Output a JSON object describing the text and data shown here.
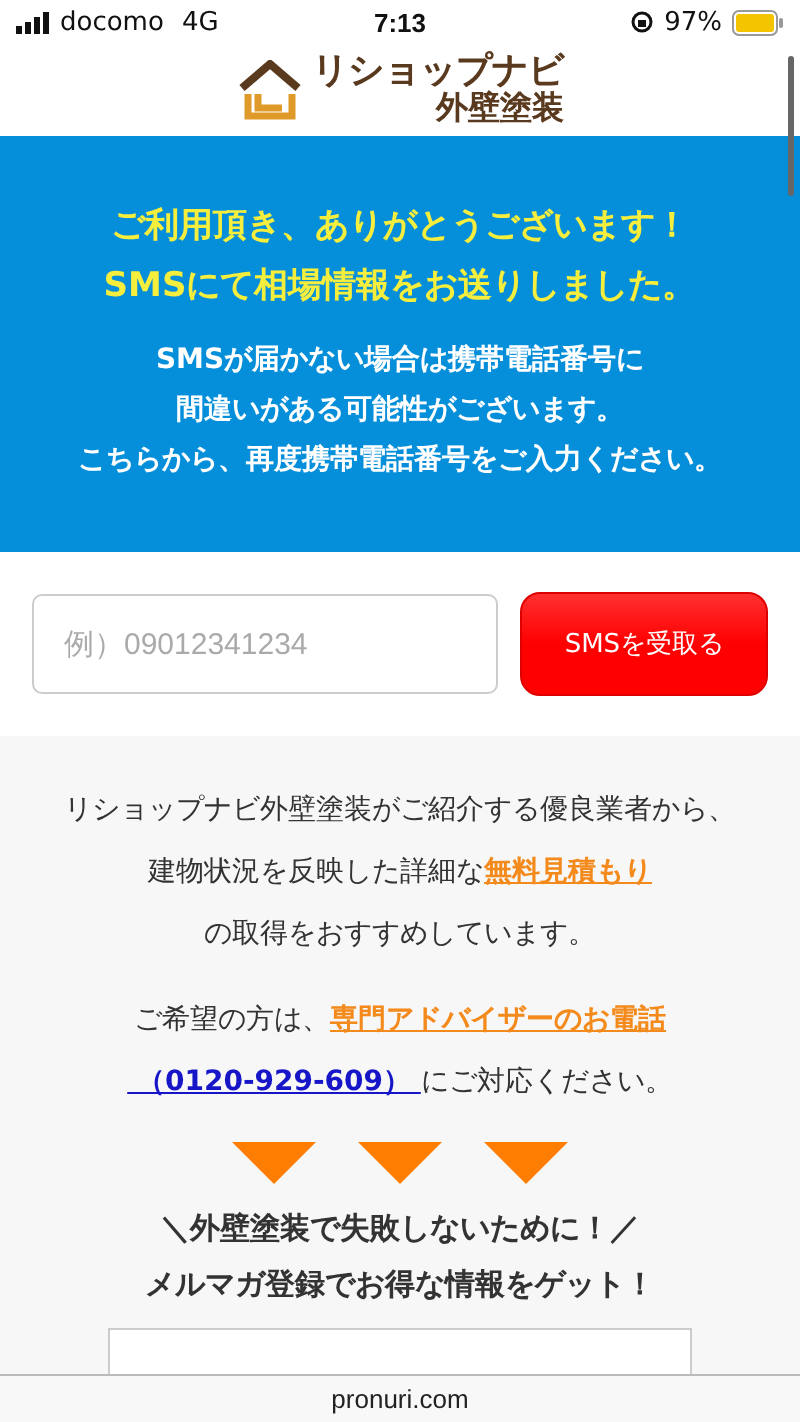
{
  "status_bar": {
    "carrier": "docomo",
    "network": "4G",
    "time": "7:13",
    "battery": "97%"
  },
  "header": {
    "logo_line_1": "リショップナビ",
    "logo_line_2": "外壁塗装"
  },
  "banner": {
    "headline": [
      "ご利用頂き、ありがとうございます！",
      "SMSにて相場情報をお送りしました。"
    ],
    "message": [
      "SMSが届かない場合は携帯電話番号に",
      "間違いがある可能性がございます。",
      "こちらから、再度携帯電話番号をご入力ください。"
    ]
  },
  "form": {
    "phone_placeholder": "例）09012341234",
    "submit": "SMSを受取る"
  },
  "paragraphs": [
    [
      [
        {
          "kind": "text",
          "text": "リショップナビ外壁塗装がご紹介する優良業者から、"
        }
      ],
      [
        {
          "kind": "text",
          "text": "建物状況を反映した詳細な"
        },
        {
          "kind": "link",
          "text": "無料見積もり"
        }
      ],
      [
        {
          "kind": "text",
          "text": "の取得をおすすめしています。"
        }
      ]
    ],
    [
      [
        {
          "kind": "text",
          "text": "ご希望の方は、"
        },
        {
          "kind": "link",
          "text": "専門アドバイザーのお電話"
        }
      ],
      [
        {
          "kind": "phone",
          "text": " （0120-929-609） "
        },
        {
          "kind": "text",
          "text": "にご対応ください。"
        }
      ]
    ]
  ],
  "newsletter_heading": [
    "＼外壁塗装で失敗しないために！／",
    "メルマガ登録でお得な情報をゲット！"
  ],
  "url_bar": {
    "domain": "pronuri.com"
  }
}
